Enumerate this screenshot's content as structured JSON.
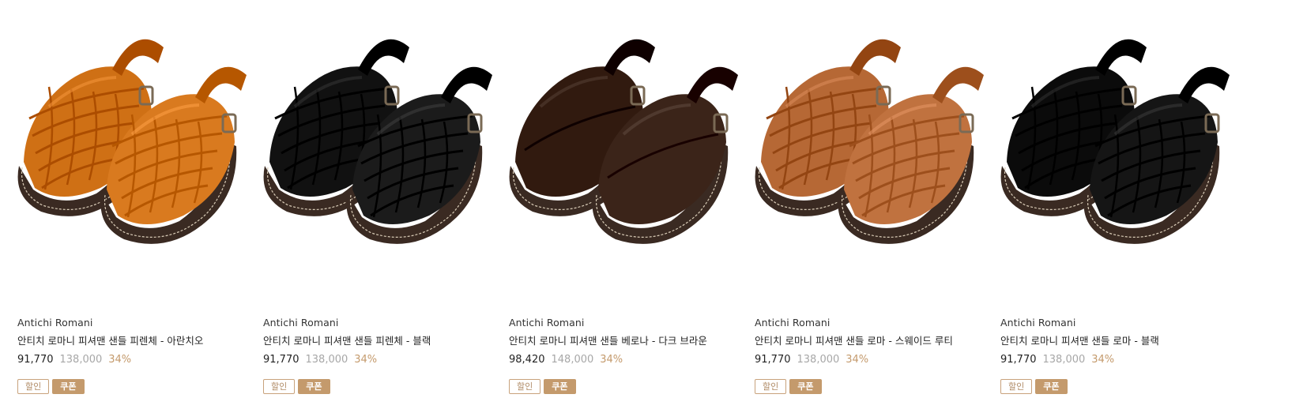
{
  "badge_colors": {
    "outline": "#c8a27c",
    "fill": "#c49a6c",
    "rate": "#c49a6c"
  },
  "products": [
    {
      "image": "orange-leather-fisherman-sandals",
      "color": "#d97a1f",
      "brand": "Antichi Romani",
      "name": "안티치 로마니 피셔맨 샌들 피렌체 - 아란치오",
      "sale_price": "91,770",
      "original_price": "138,000",
      "discount_rate": "34%",
      "badges": [
        "할인",
        "쿠폰"
      ]
    },
    {
      "image": "black-leather-fisherman-sandals",
      "color": "#1b1b1b",
      "brand": "Antichi Romani",
      "name": "안티치 로마니 피셔맨 샌들 피렌체 - 블랙",
      "sale_price": "91,770",
      "original_price": "138,000",
      "discount_rate": "34%",
      "badges": [
        "할인",
        "쿠폰"
      ]
    },
    {
      "image": "dark-brown-leather-sandals",
      "color": "#3b2419",
      "brand": "Antichi Romani",
      "name": "안티치 로마니 피셔맨 샌들 베로나 - 다크 브라운",
      "sale_price": "98,420",
      "original_price": "148,000",
      "discount_rate": "34%",
      "badges": [
        "할인",
        "쿠폰"
      ]
    },
    {
      "image": "suede-rust-fisherman-sandals",
      "color": "#c0723f",
      "brand": "Antichi Romani",
      "name": "안티치 로마니 피셔맨 샌들 로마 - 스웨이드 루티",
      "sale_price": "91,770",
      "original_price": "138,000",
      "discount_rate": "34%",
      "badges": [
        "할인",
        "쿠폰"
      ]
    },
    {
      "image": "black-leather-fisherman-sandals",
      "color": "#151515",
      "brand": "Antichi Romani",
      "name": "안티치 로마니 피셔맨 샌들 로마 - 블랙",
      "sale_price": "91,770",
      "original_price": "138,000",
      "discount_rate": "34%",
      "badges": [
        "할인",
        "쿠폰"
      ]
    }
  ]
}
